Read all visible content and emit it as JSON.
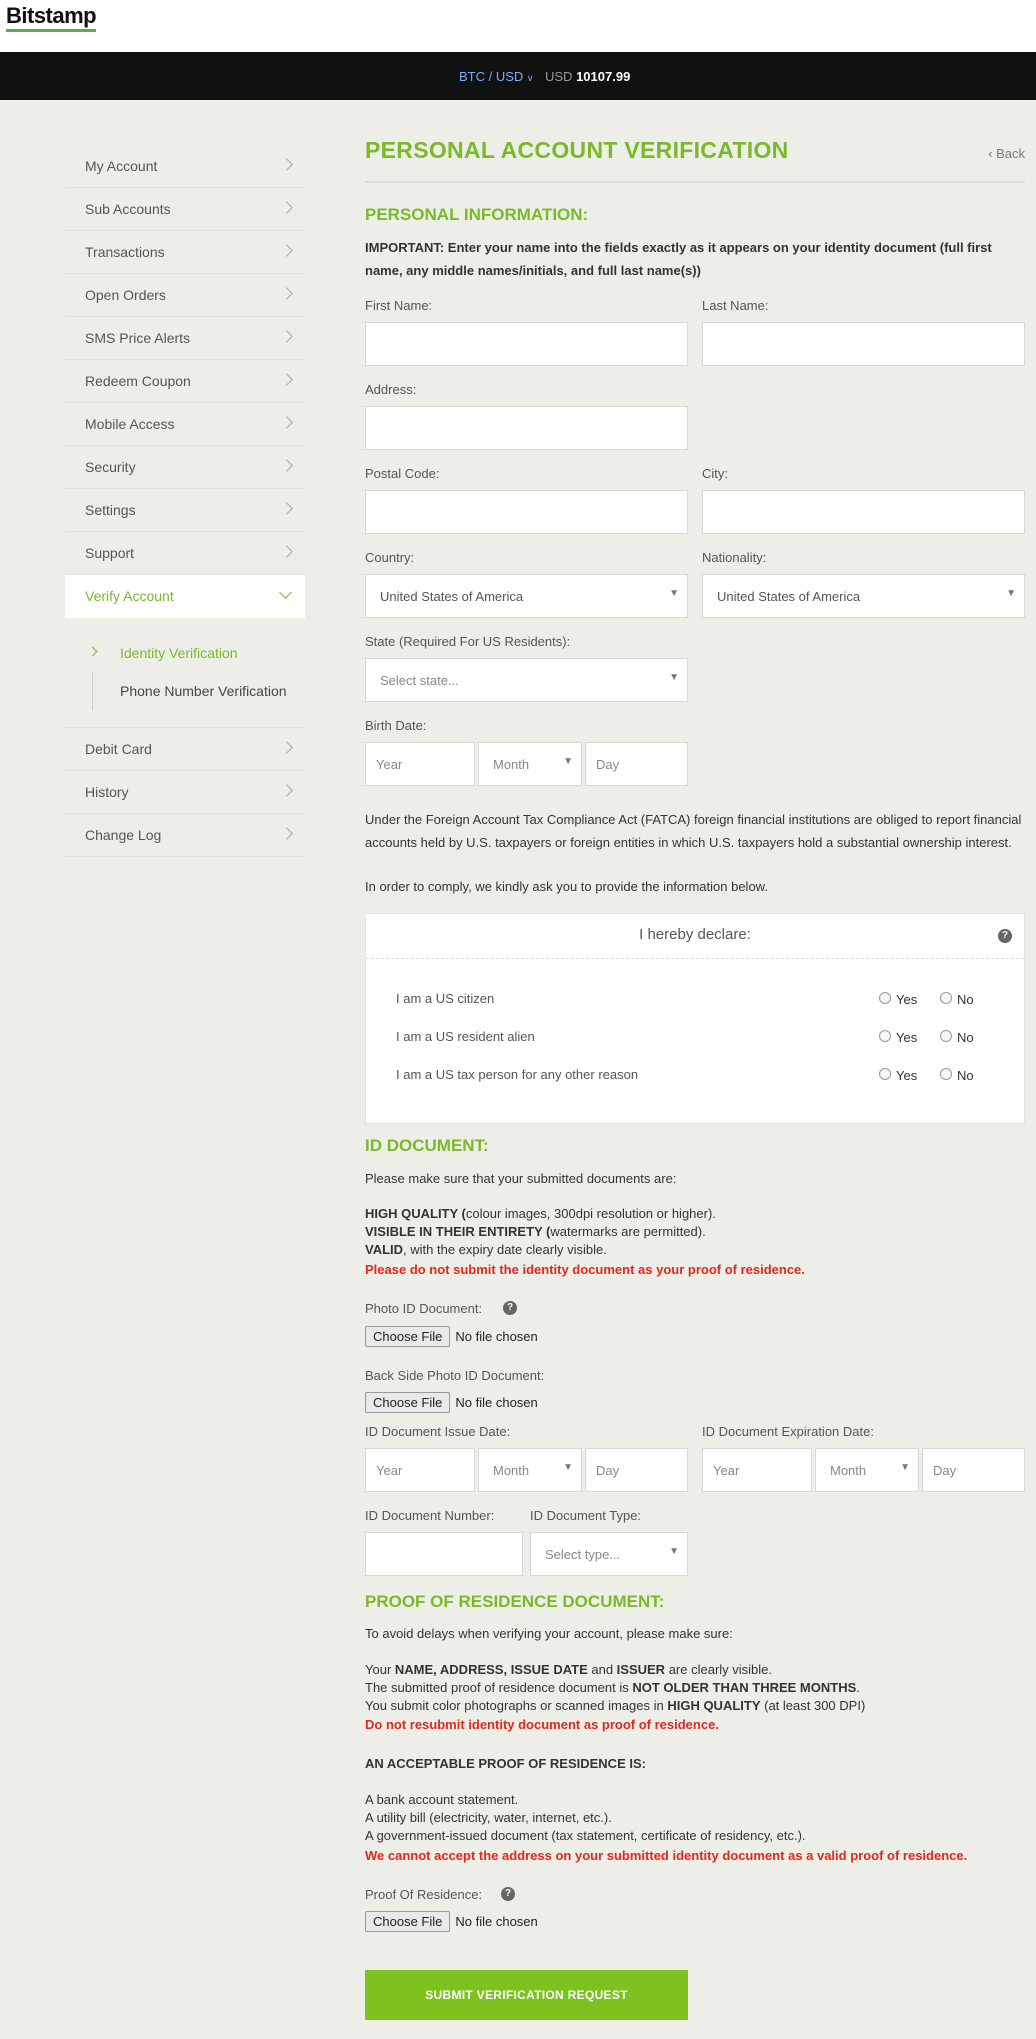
{
  "logo": "Bitstamp",
  "ticker": {
    "pair": "BTC / USD",
    "currency": "USD",
    "price": "10107.99"
  },
  "sidebar": {
    "items": [
      "My Account",
      "Sub Accounts",
      "Transactions",
      "Open Orders",
      "SMS Price Alerts",
      "Redeem Coupon",
      "Mobile Access",
      "Security",
      "Settings",
      "Support"
    ],
    "active": "Verify Account",
    "sub": [
      "Identity Verification",
      "Phone Number Verification"
    ],
    "after": [
      "Debit Card",
      "History",
      "Change Log"
    ]
  },
  "page": {
    "title": "PERSONAL ACCOUNT VERIFICATION",
    "back": "Back"
  },
  "personal": {
    "heading": "PERSONAL INFORMATION:",
    "important": "IMPORTANT: Enter your name into the fields exactly as it appears on your identity document (full first name, any middle names/initials, and full last name(s))",
    "first_name": "First Name:",
    "last_name": "Last Name:",
    "address": "Address:",
    "postal": "Postal Code:",
    "city": "City:",
    "country": "Country:",
    "country_value": "United States of America",
    "nationality": "Nationality:",
    "nationality_value": "United States of America",
    "state": "State (Required For US Residents):",
    "state_placeholder": "Select state...",
    "birth": "Birth Date:",
    "year": "Year",
    "month": "Month",
    "day": "Day"
  },
  "fatca": {
    "text1": "Under the Foreign Account Tax Compliance Act (FATCA) foreign financial institutions are obliged to report financial accounts held by U.S. taxpayers or foreign entities in which U.S. taxpayers hold a substantial ownership interest.",
    "text2": "In order to comply, we kindly ask you to provide the information below.",
    "declare": "I hereby declare:",
    "rows": [
      "I am a US citizen",
      "I am a US resident alien",
      "I am a US tax person for any other reason"
    ],
    "yes": "Yes",
    "no": "No"
  },
  "id_doc": {
    "heading": "ID DOCUMENT:",
    "intro": "Please make sure that your submitted documents are:",
    "q1b": "HIGH QUALITY (",
    "q1": "colour images, 300dpi resolution or higher).",
    "q2b": "VISIBLE IN THEIR ENTIRETY (",
    "q2": "watermarks are permitted).",
    "q3b": "VALID",
    "q3": ", with the expiry date clearly visible.",
    "warn": "Please do not submit the identity document as your proof of residence.",
    "photo": "Photo ID Document:",
    "back_side": "Back Side Photo ID Document:",
    "choose": "Choose File",
    "none": "No file chosen",
    "issue": "ID Document Issue Date:",
    "expiry": "ID Document Expiration Date:",
    "number": "ID Document Number:",
    "type": "ID Document Type:",
    "type_placeholder": "Select type..."
  },
  "proof": {
    "heading": "PROOF OF RESIDENCE DOCUMENT:",
    "intro": "To avoid delays when verifying your account, please make sure:",
    "l1a": "Your ",
    "l1b": "NAME, ADDRESS, ISSUE DATE",
    "l1c": " and ",
    "l1d": "ISSUER",
    "l1e": " are clearly visible.",
    "l2a": "The submitted proof of residence document is ",
    "l2b": "NOT OLDER THAN THREE MONTHS",
    "l2c": ".",
    "l3a": "You submit color photographs or scanned images in ",
    "l3b": "HIGH QUALITY",
    "l3c": " (at least 300 DPI)",
    "warn1": "Do not resubmit identity document as proof of residence.",
    "acceptable": "AN ACCEPTABLE PROOF OF RESIDENCE IS:",
    "a1": "A bank account statement.",
    "a2": "A utility bill (electricity, water, internet, etc.).",
    "a3": "A government-issued document (tax statement, certificate of residency, etc.).",
    "warn2": "We cannot accept the address on your submitted identity document as a valid proof of residence.",
    "label": "Proof Of Residence:"
  },
  "submit": "SUBMIT VERIFICATION REQUEST",
  "colors": {
    "accent": "#7ab928",
    "warning": "#e2281b",
    "button": "#7dc21e"
  }
}
